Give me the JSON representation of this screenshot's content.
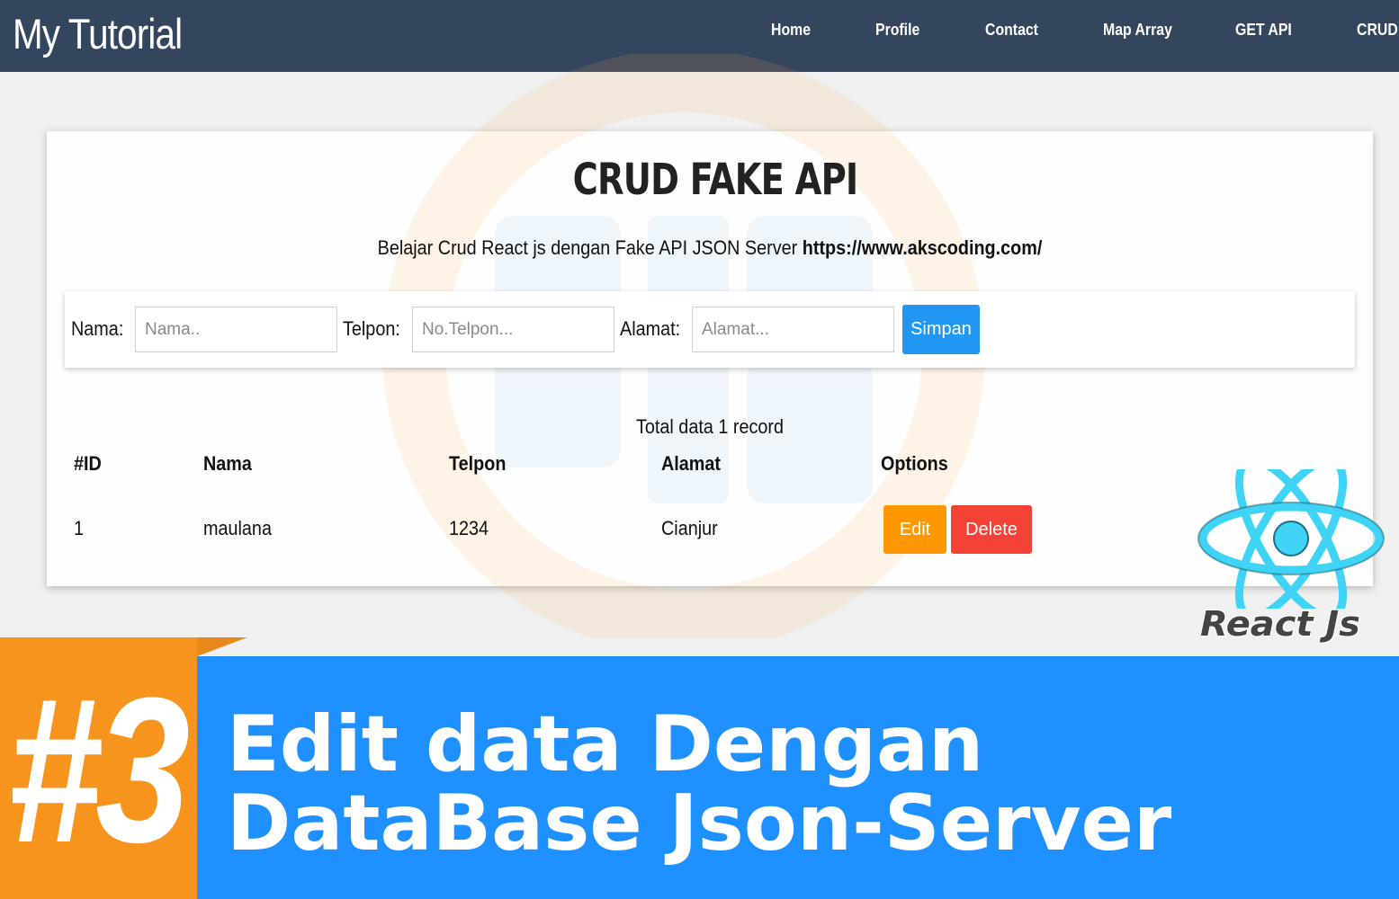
{
  "nav": {
    "brand": "My Tutorial",
    "links": [
      "Home",
      "Profile",
      "Contact",
      "Map Array",
      "GET API",
      "CRUD"
    ]
  },
  "card": {
    "title": "CRUD FAKE API",
    "subtitle_text": "Belajar Crud React js dengan Fake API JSON Server ",
    "subtitle_link": "https://www.akscoding.com/"
  },
  "form": {
    "nama_label": "Nama:",
    "nama_placeholder": "Nama..",
    "telpon_label": "Telpon:",
    "telpon_placeholder": "No.Telpon...",
    "alamat_label": "Alamat:",
    "alamat_placeholder": "Alamat...",
    "submit_label": "Simpan"
  },
  "table": {
    "total_text": "Total data 1 record",
    "headers": [
      "#ID",
      "Nama",
      "Telpon",
      "Alamat",
      "Options"
    ],
    "rows": [
      {
        "id": "1",
        "nama": "maulana",
        "telpon": "1234",
        "alamat": "Cianjur"
      }
    ],
    "edit_label": "Edit",
    "delete_label": "Delete"
  },
  "badge": {
    "text": "React Js",
    "icon": "react-atom-icon"
  },
  "banner": {
    "episode": "#3",
    "line1": "Edit data Dengan",
    "line2": "DataBase Json-Server"
  },
  "colors": {
    "navbar": "#34465d",
    "primary": "#2196f3",
    "warning": "#ff9800",
    "danger": "#f44336",
    "banner_orange": "#f7941d",
    "banner_blue": "#1e90ff",
    "react_cyan": "#3fd3f5"
  }
}
